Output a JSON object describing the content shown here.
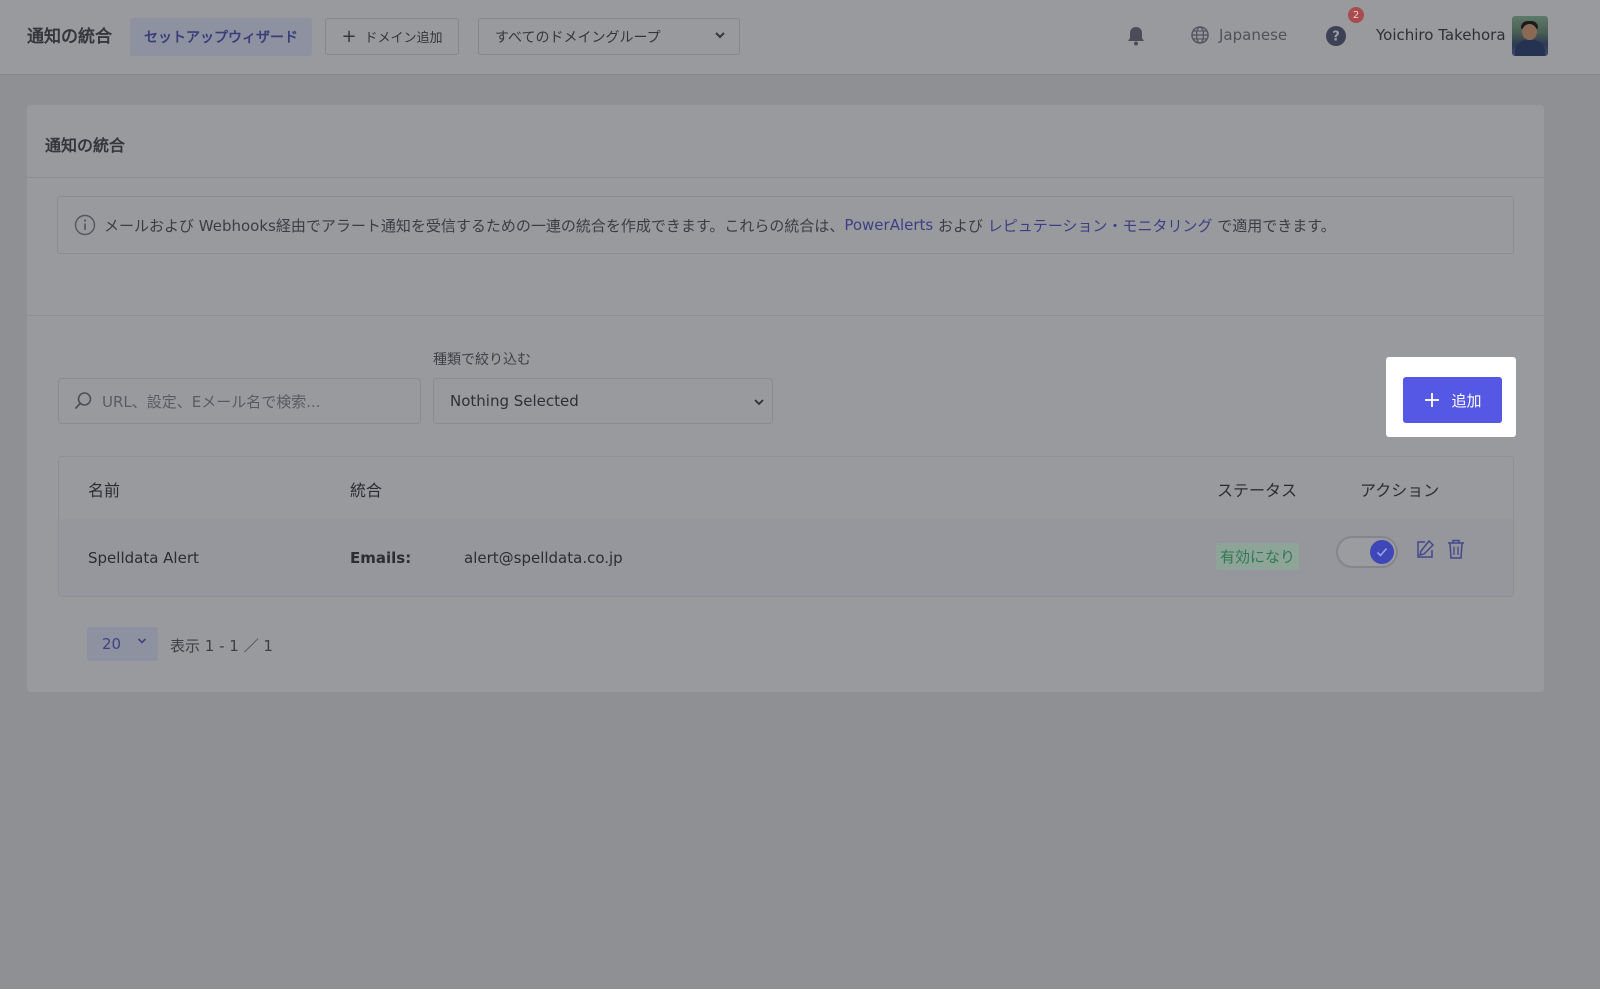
{
  "header": {
    "title": "通知の統合",
    "wizard_label": "セットアップウィザード",
    "add_domain_label": "ドメイン追加",
    "domain_group_selected": "すべてのドメイングループ",
    "language": "Japanese",
    "help_badge_count": "2",
    "user_name": "Yoichiro Takehora"
  },
  "page": {
    "title": "通知の統合",
    "info": {
      "text_before": "メールおよび Webhooks経由でアラート通知を受信するための一連の統合を作成できます。これらの統合は、",
      "link1": "PowerAlerts",
      "text_middle": " および ",
      "link2": "レピュテーション・モニタリング",
      "text_after": " で適用できます。"
    },
    "search": {
      "placeholder": "URL、設定、Eメール名で検索..."
    },
    "filter": {
      "label": "種類で絞り込む",
      "selected": "Nothing Selected"
    },
    "add_button_label": "追加"
  },
  "table": {
    "columns": [
      "名前",
      "統合",
      "ステータス",
      "アクション"
    ],
    "rows": [
      {
        "name": "Spelldata Alert",
        "integration_label": "Emails:",
        "integration_value": "alert@spelldata.co.jp",
        "status": "有効になり",
        "enabled": true
      }
    ]
  },
  "pagination": {
    "page_size": "20",
    "range_text": "表示 1 - 1 ／ 1"
  },
  "colors": {
    "accent": "#5558e4",
    "status_green": "#2e7a54",
    "overlay_gray": "#999a9d"
  }
}
